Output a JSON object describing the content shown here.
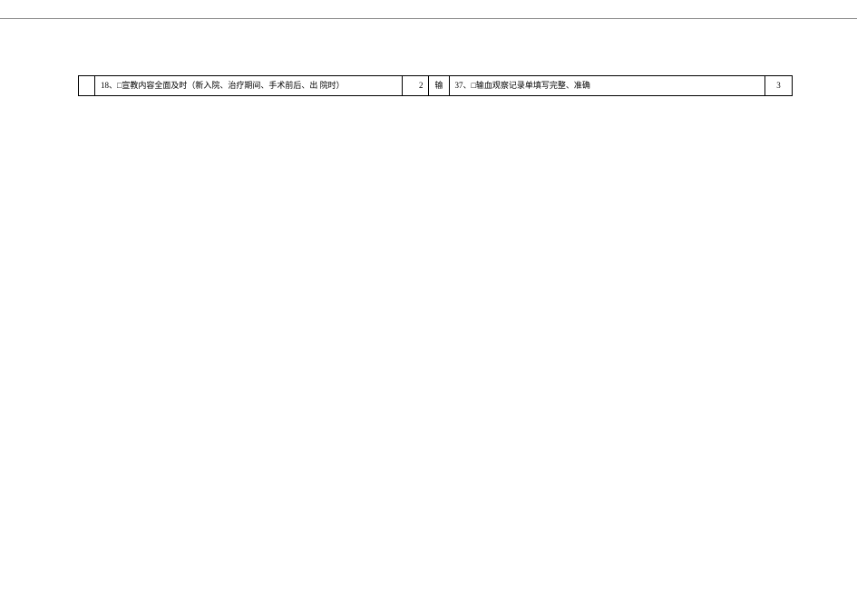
{
  "row": {
    "left": {
      "category": "",
      "number": "18",
      "item_text": "18、□宣教内容全面及时（新入院、治疗期间、手术前后、出 院时）",
      "score": "2"
    },
    "right": {
      "category": "输",
      "number": "37",
      "item_text": "37、□输血观察记录单填写完整、准确",
      "score": "3"
    }
  }
}
